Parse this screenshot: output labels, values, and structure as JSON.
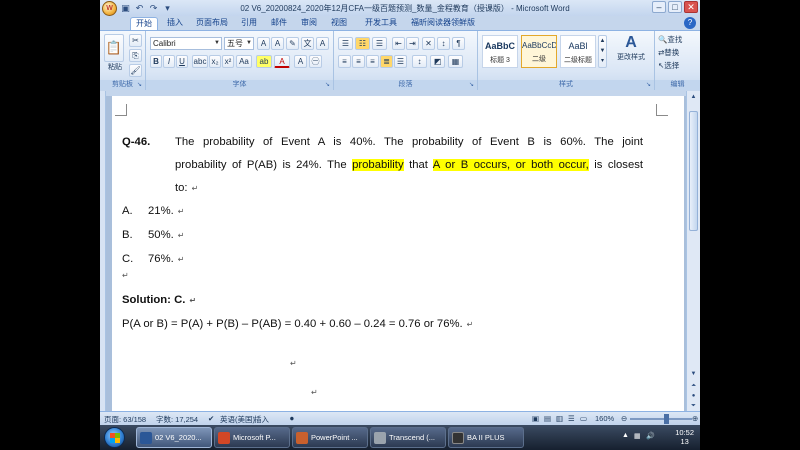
{
  "window": {
    "title": "02 V6_20200824_2020年12月CFA一级百题预测_数量_金程教育（授课版） - Microsoft Word"
  },
  "tabs": [
    "开始",
    "插入",
    "页面布局",
    "引用",
    "邮件",
    "审阅",
    "视图",
    "开发工具",
    "福昕阅读器领鲜版"
  ],
  "ribbon": {
    "paste_label": "粘贴",
    "font_name": "Calibri",
    "font_size": "五号",
    "styles": [
      {
        "sample": "AaBbC",
        "name": "标题 3"
      },
      {
        "sample": "AaBbCcDd",
        "name": "二级"
      },
      {
        "sample": "AaBl",
        "name": "二级标题"
      }
    ],
    "change_styles": "更改样式",
    "edit_find": "查找",
    "edit_replace": "替换",
    "edit_select": "选择",
    "group_labels": {
      "clipboard": "剪贴板",
      "font": "字体",
      "paragraph": "段落",
      "styles": "样式",
      "editing": "编辑"
    }
  },
  "document": {
    "question_number": "Q-46.",
    "question_line1": "The probability of Event A is 40%. The probability of Event B is 60%. The joint",
    "question_line2_pre": "probability of P(AB) is 24%. The ",
    "question_line2_hl1": "probability",
    "question_line2_mid": " that ",
    "question_line2_hl2": "A or B occurs, or both occur,",
    "question_line2_post": " is closest",
    "question_line3": "to:",
    "options": [
      {
        "letter": "A.",
        "value": "21%."
      },
      {
        "letter": "B.",
        "value": "50%."
      },
      {
        "letter": "C.",
        "value": "76%."
      }
    ],
    "solution": "Solution: C.",
    "formula": "P(A or B) = P(A) + P(B) – P(AB) = 0.40 + 0.60 – 0.24 = 0.76 or 76%.",
    "paragraph_mark": "↵"
  },
  "status": {
    "page": "页面: 63/158",
    "words": "字数: 17,254",
    "language": "英语(美国)",
    "mode": "插入",
    "zoom": "160%"
  },
  "taskbar": {
    "items": [
      "02 V6_2020...",
      "Microsoft P...",
      "PowerPoint ...",
      "Transcend (...",
      "BA II PLUS"
    ],
    "clock_time": "10:52",
    "clock_date": "13"
  },
  "colors": {
    "highlight": "#ffff00",
    "ribbon_accent": "#15428b"
  }
}
